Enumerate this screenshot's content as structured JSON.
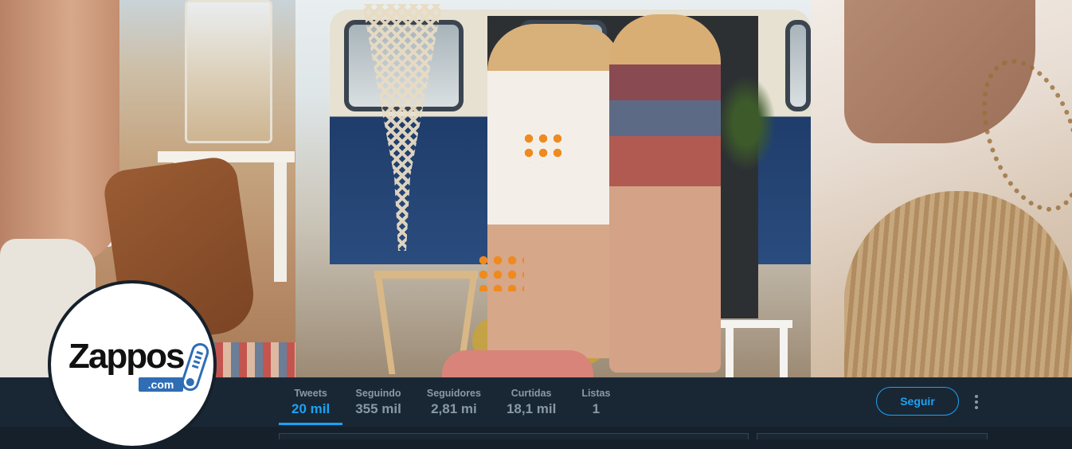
{
  "profile": {
    "avatar": {
      "logo_word": "Zappos",
      "logo_domain": ".com"
    }
  },
  "nav": {
    "stats": [
      {
        "label": "Tweets",
        "value": "20 mil",
        "active": true
      },
      {
        "label": "Seguindo",
        "value": "355 mil",
        "active": false
      },
      {
        "label": "Seguidores",
        "value": "2,81 mi",
        "active": false
      },
      {
        "label": "Curtidas",
        "value": "18,1 mil",
        "active": false
      },
      {
        "label": "Listas",
        "value": "1",
        "active": false
      }
    ],
    "follow_label": "Seguir",
    "more_icon": "more-vertical-icon"
  },
  "colors": {
    "accent": "#1da1f2",
    "background": "#15202b",
    "bar": "#192734",
    "muted_text": "#8899a6"
  }
}
